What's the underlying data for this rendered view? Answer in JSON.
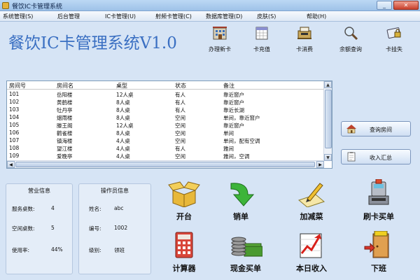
{
  "window": {
    "title": "餐饮IC卡管理系统",
    "min": "_",
    "max": "□",
    "close": "✕"
  },
  "menu": [
    "系统管理(S)",
    "后台管理",
    "IC卡管理(U)",
    "射频卡管理(C)",
    "数据库管理(D)",
    "皮肤(S)",
    "帮助(H)"
  ],
  "app_title": "餐饮IC卡管理系统V1.0",
  "toolbar": [
    "办理新卡",
    "卡充值",
    "卡消费",
    "余额查询",
    "卡挂失"
  ],
  "table": {
    "columns": [
      "房间号",
      "房间名",
      "桌型",
      "状态",
      "备注"
    ],
    "rows": [
      [
        "101",
        "岳阳楼",
        "12人桌",
        "有人",
        "靠近窗户"
      ],
      [
        "102",
        "黄鹤楼",
        "8人桌",
        "有人",
        "靠近窗户"
      ],
      [
        "103",
        "牡丹亭",
        "8人桌",
        "有人",
        "靠近长湖"
      ],
      [
        "104",
        "烟雨楼",
        "8人桌",
        "空闲",
        "单间，靠近窗户"
      ],
      [
        "105",
        "滕王阁",
        "12人桌",
        "空闲",
        "靠近窗户"
      ],
      [
        "106",
        "鹳雀楼",
        "8人桌",
        "空闲",
        "单间"
      ],
      [
        "107",
        "镇海楼",
        "4人桌",
        "空闲",
        "单间，配有空调"
      ],
      [
        "108",
        "望江楼",
        "4人桌",
        "有人",
        "雅间"
      ],
      [
        "109",
        "爱晚亭",
        "4人桌",
        "空闲",
        "雅间，空调"
      ]
    ]
  },
  "side_buttons": [
    "查询房间",
    "收入汇总"
  ],
  "business_info": {
    "title": "营业信息",
    "rows": [
      [
        "服务桌数:",
        "4"
      ],
      [
        "空闲桌数:",
        "5"
      ],
      [
        "使用率:",
        "44%"
      ]
    ]
  },
  "operator_info": {
    "title": "操作员信息",
    "rows": [
      [
        "姓名:",
        "abc"
      ],
      [
        "编号:",
        "1002"
      ],
      [
        "级别:",
        "领班"
      ]
    ]
  },
  "actions": [
    "开台",
    "销单",
    "加减菜",
    "刷卡买单",
    "计算器",
    "现金买单",
    "本日收入",
    "下班"
  ]
}
